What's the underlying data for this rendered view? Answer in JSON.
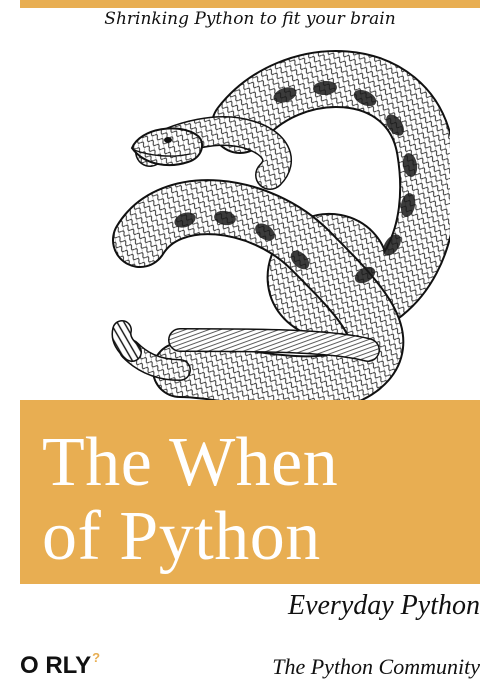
{
  "cover": {
    "tagline": "Shrinking Python to fit your brain",
    "title_line1": "The When",
    "title_line2": "of Python",
    "subtitle": "Everyday Python",
    "publisher": "O RLY",
    "publisher_mark": "?",
    "author": "The Python Community"
  },
  "illustration": {
    "icon": "rattlesnake-illustration"
  },
  "colors": {
    "accent": "#E8AE52",
    "title_text": "#FFFFFF",
    "body_text": "#111111"
  }
}
